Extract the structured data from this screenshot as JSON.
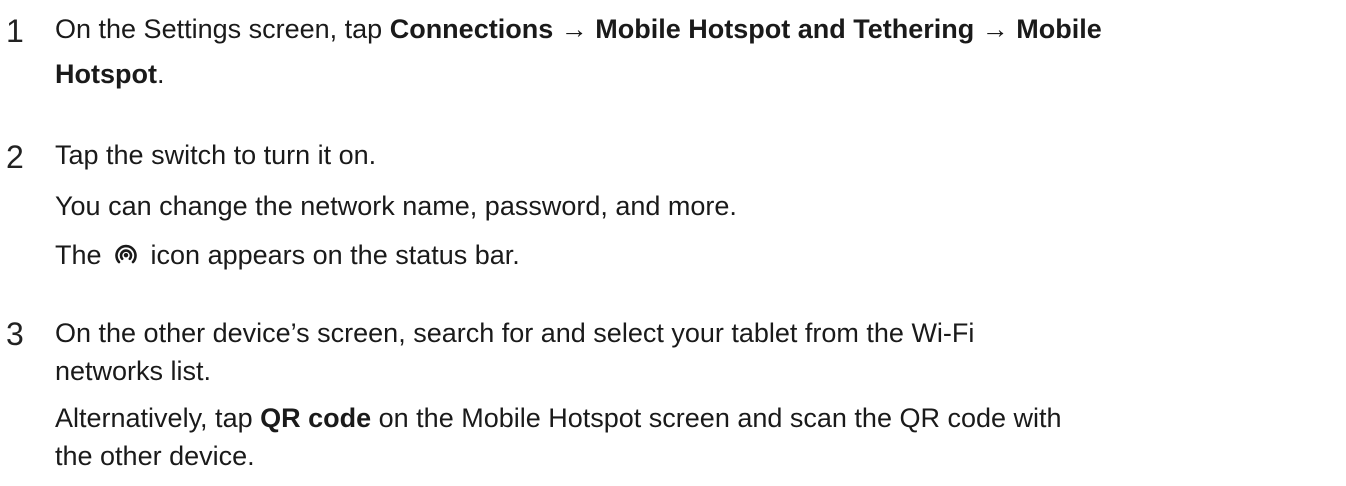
{
  "steps": [
    {
      "number": "1",
      "line1": {
        "prefix": "On the Settings screen, tap ",
        "bold1": "Connections",
        "arrow1": " → ",
        "bold2": "Mobile Hotspot and Tethering",
        "arrow2": " → ",
        "bold3": "Mobile"
      },
      "line2": {
        "bold": "Hotspot",
        "suffix": "."
      }
    },
    {
      "number": "2",
      "line1": "Tap the switch to turn it on.",
      "line2": "You can change the network name, password, and more.",
      "line3": {
        "prefix": "The ",
        "icon": "mobile-hotspot-icon",
        "suffix": " icon appears on the status bar."
      }
    },
    {
      "number": "3",
      "line1": "On the other device’s screen, search for and select your tablet from the Wi-Fi",
      "line2": "networks list.",
      "line3": {
        "prefix": "Alternatively, tap ",
        "bold": "QR code",
        "suffix": " on the Mobile Hotspot screen and scan the QR code with"
      },
      "line4": "the other device."
    }
  ]
}
